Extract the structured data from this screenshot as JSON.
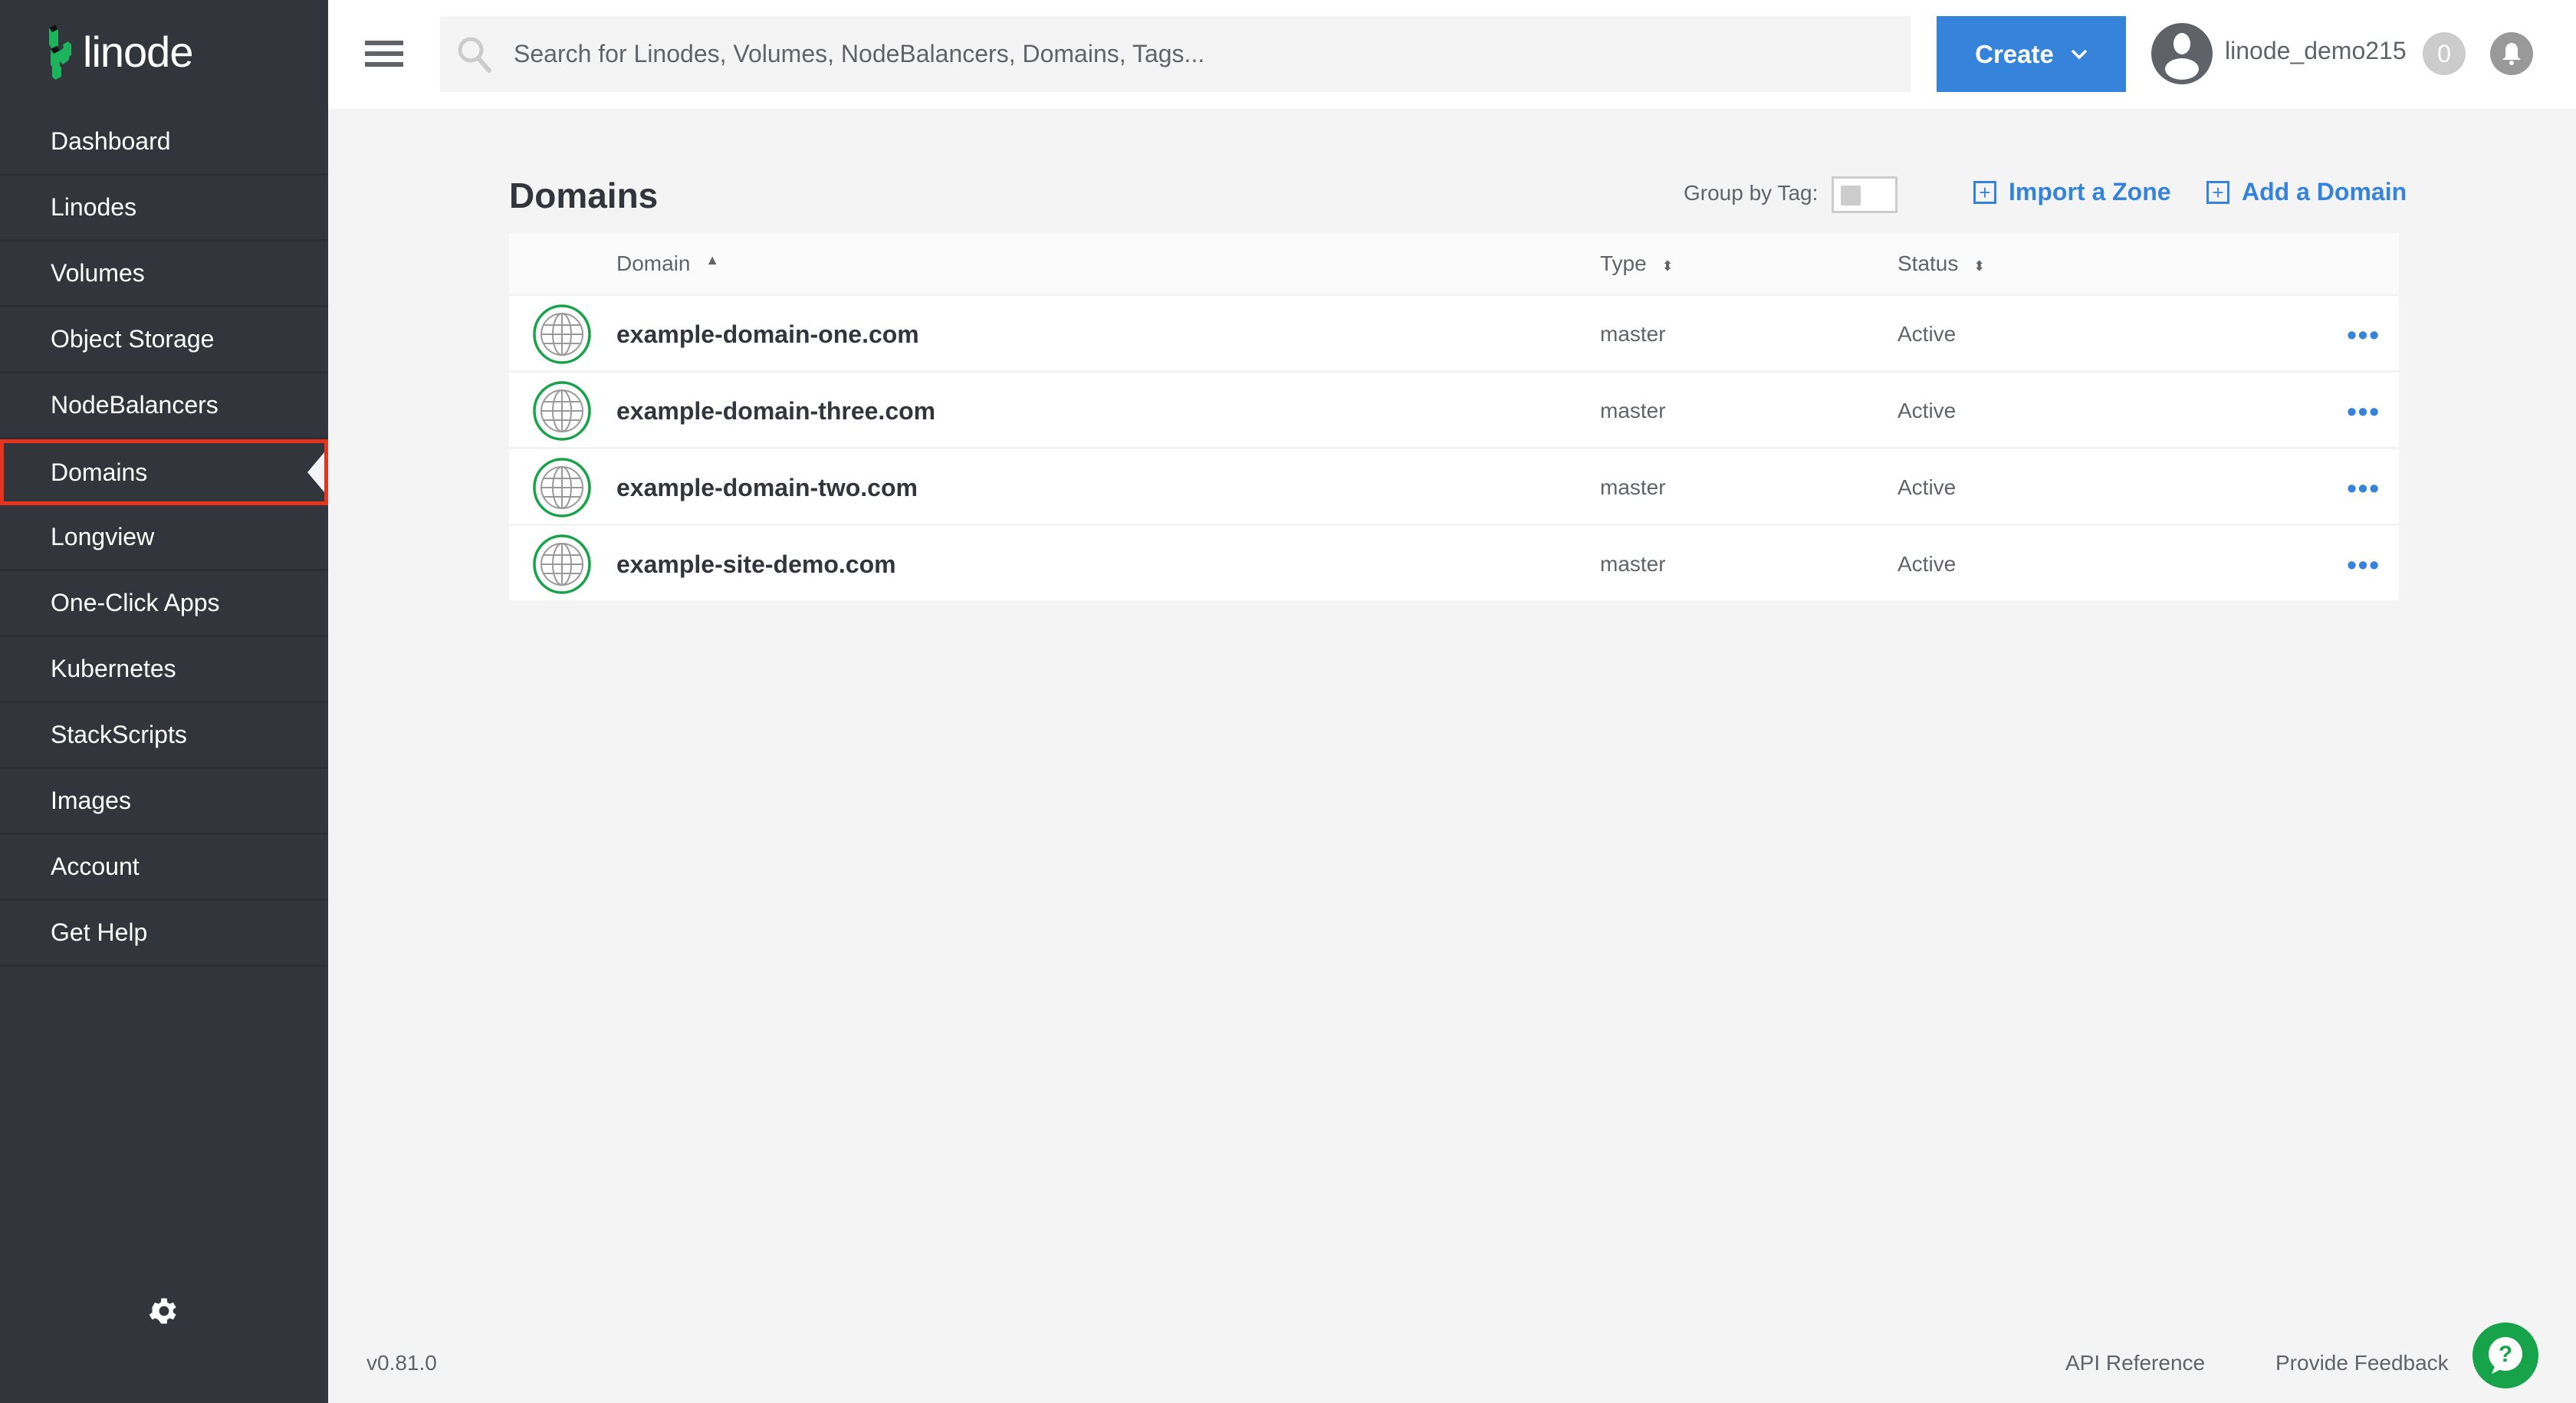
{
  "brand": {
    "name": "linode",
    "logo_color": "#1cb35c"
  },
  "sidebar": {
    "items": [
      {
        "label": "Dashboard"
      },
      {
        "label": "Linodes"
      },
      {
        "label": "Volumes"
      },
      {
        "label": "Object Storage"
      },
      {
        "label": "NodeBalancers"
      },
      {
        "label": "Domains",
        "active": true
      },
      {
        "label": "Longview"
      },
      {
        "label": "One-Click Apps"
      },
      {
        "label": "Kubernetes"
      },
      {
        "label": "StackScripts"
      },
      {
        "label": "Images"
      },
      {
        "label": "Account"
      },
      {
        "label": "Get Help"
      }
    ]
  },
  "topbar": {
    "search_placeholder": "Search for Linodes, Volumes, NodeBalancers, Domains, Tags...",
    "create_label": "Create",
    "username": "linode_demo215",
    "notification_count": "0"
  },
  "page": {
    "title": "Domains",
    "group_by_tag": "Group by Tag:",
    "import_zone": "Import a Zone",
    "add_domain": "Add a Domain"
  },
  "table": {
    "headers": {
      "domain": "Domain",
      "type": "Type",
      "status": "Status"
    },
    "rows": [
      {
        "domain": "example-domain-one.com",
        "type": "master",
        "status": "Active"
      },
      {
        "domain": "example-domain-three.com",
        "type": "master",
        "status": "Active"
      },
      {
        "domain": "example-domain-two.com",
        "type": "master",
        "status": "Active"
      },
      {
        "domain": "example-site-demo.com",
        "type": "master",
        "status": "Active"
      }
    ]
  },
  "footer": {
    "version": "v0.81.0",
    "api_reference": "API Reference",
    "feedback": "Provide Feedback"
  },
  "colors": {
    "accent": "#3683dc",
    "sidebar": "#32363c",
    "active_border": "#e5331d",
    "success": "#17a34a"
  }
}
